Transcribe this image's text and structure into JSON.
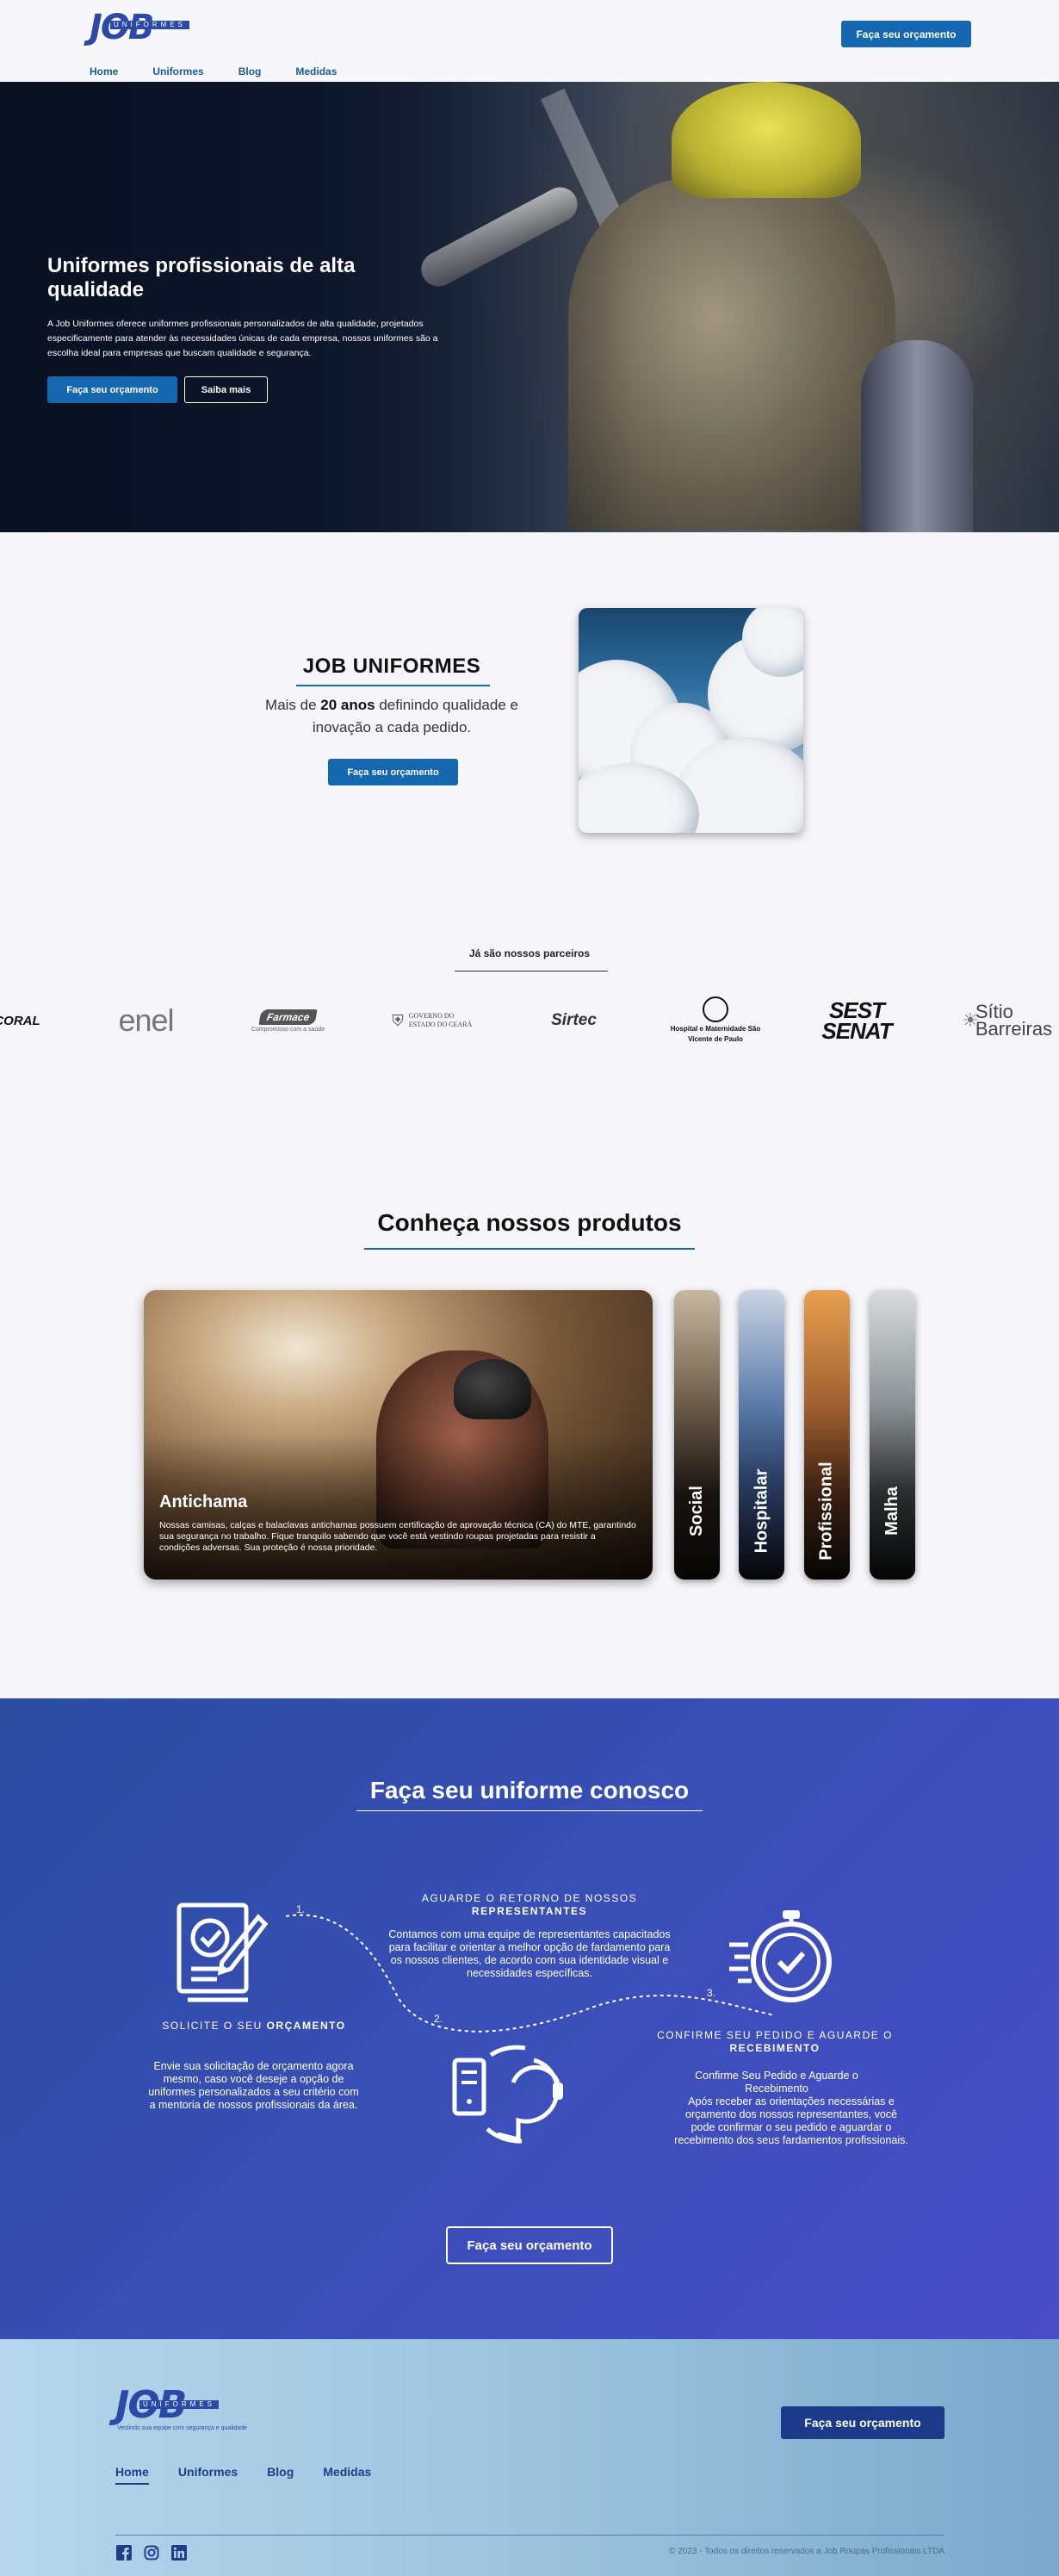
{
  "header": {
    "logo_text": "JOB",
    "logo_sub": "UNIFORMES",
    "cta": "Faça seu orçamento",
    "nav": [
      {
        "label": "Home",
        "active": true
      },
      {
        "label": "Uniformes"
      },
      {
        "label": "Blog"
      },
      {
        "label": "Medidas"
      }
    ]
  },
  "hero": {
    "title": "Uniformes profissionais de alta qualidade",
    "description": "A Job Uniformes oferece uniformes profissionais personalizados de alta qualidade, projetados especificamente para atender às necessidades únicas de cada empresa, nossos uniformes são a escolha ideal para empresas que buscam qualidade e segurança.",
    "cta_primary": "Faça seu orçamento",
    "cta_secondary": "Saiba mais"
  },
  "about": {
    "title": "JOB UNIFORMES",
    "text_before": "Mais de ",
    "text_bold": "20 anos",
    "text_after": " definindo qualidade e inovação a cada pedido.",
    "cta": "Faça seu orçamento"
  },
  "partners": {
    "label": "Já são nossos parceiros",
    "items": [
      {
        "name": "CORAL"
      },
      {
        "name": "enel"
      },
      {
        "name": "Farmace",
        "sub": "Compromisso com a saúde"
      },
      {
        "name": "GOVERNO DO ESTADO DO CEARÁ"
      },
      {
        "name": "Sirtec"
      },
      {
        "name": "Hospital e Maternidade São Vicente de Paulo"
      },
      {
        "name": "SEST SENAT"
      },
      {
        "name": "Sítio Barreiras"
      }
    ]
  },
  "products": {
    "title": "Conheça nossos produtos",
    "featured": {
      "title": "Antichama",
      "description": "Nossas camisas, calças e balaclavas antichamas possuem certificação de aprovação técnica (CA) do MTE, garantindo sua segurança no trabalho. Fique tranquilo sabendo que você está vestindo roupas projetadas para resistir a condições adversas. Sua proteção é nossa prioridade."
    },
    "tabs": [
      "Social",
      "Hospitalar",
      "Profissional",
      "Malha"
    ]
  },
  "process": {
    "title": "Faça seu uniforme conosco",
    "steps": [
      {
        "num": "1.",
        "title": "SOLICITE O SEU",
        "title_bold": "ORÇAMENTO",
        "text": "Envie sua solicitação de orçamento agora mesmo, caso você deseje a opção de uniformes personalizados a seu critério com a mentoria de nossos profissionais da área."
      },
      {
        "num": "2.",
        "title": "AGUARDE O RETORNO DE NOSSOS",
        "title_bold": "REPRESENTANTES",
        "text": "Contamos com uma equipe de representantes capacitados para facilitar e orientar a melhor opção de fardamento para os nossos clientes, de acordo com sua identidade visual e necessidades específicas."
      },
      {
        "num": "3.",
        "title": "CONFIRME SEU PEDIDO  E AGUARDE O",
        "title_bold": "RECEBIMENTO",
        "text_line1": "Confirme Seu Pedido e Aguarde o Recebimento",
        "text": "Após receber as orientações necessárias e orçamento dos nossos representantes, você pode confirmar o seu pedido e aguardar o recebimento dos seus fardamentos profissionais."
      }
    ],
    "cta": "Faça seu orçamento"
  },
  "footer": {
    "logo_text": "JOB",
    "logo_sub": "UNIFORMES",
    "logo_tagline": "Vestindo sua equipe com segurança e qualidade",
    "cta": "Faça seu orçamento",
    "nav": [
      {
        "label": "Home",
        "active": true
      },
      {
        "label": "Uniformes"
      },
      {
        "label": "Blog"
      },
      {
        "label": "Medidas"
      }
    ],
    "social": [
      "facebook-icon",
      "instagram-icon",
      "linkedin-icon"
    ],
    "copyright": "© 2023 - Todos os direitos reservados a Job Roupas Profissionais LTDA"
  },
  "colors": {
    "accent": "#1567b0",
    "process_bg": "#3a4fb8",
    "footer_bg": "#9cc4de"
  }
}
